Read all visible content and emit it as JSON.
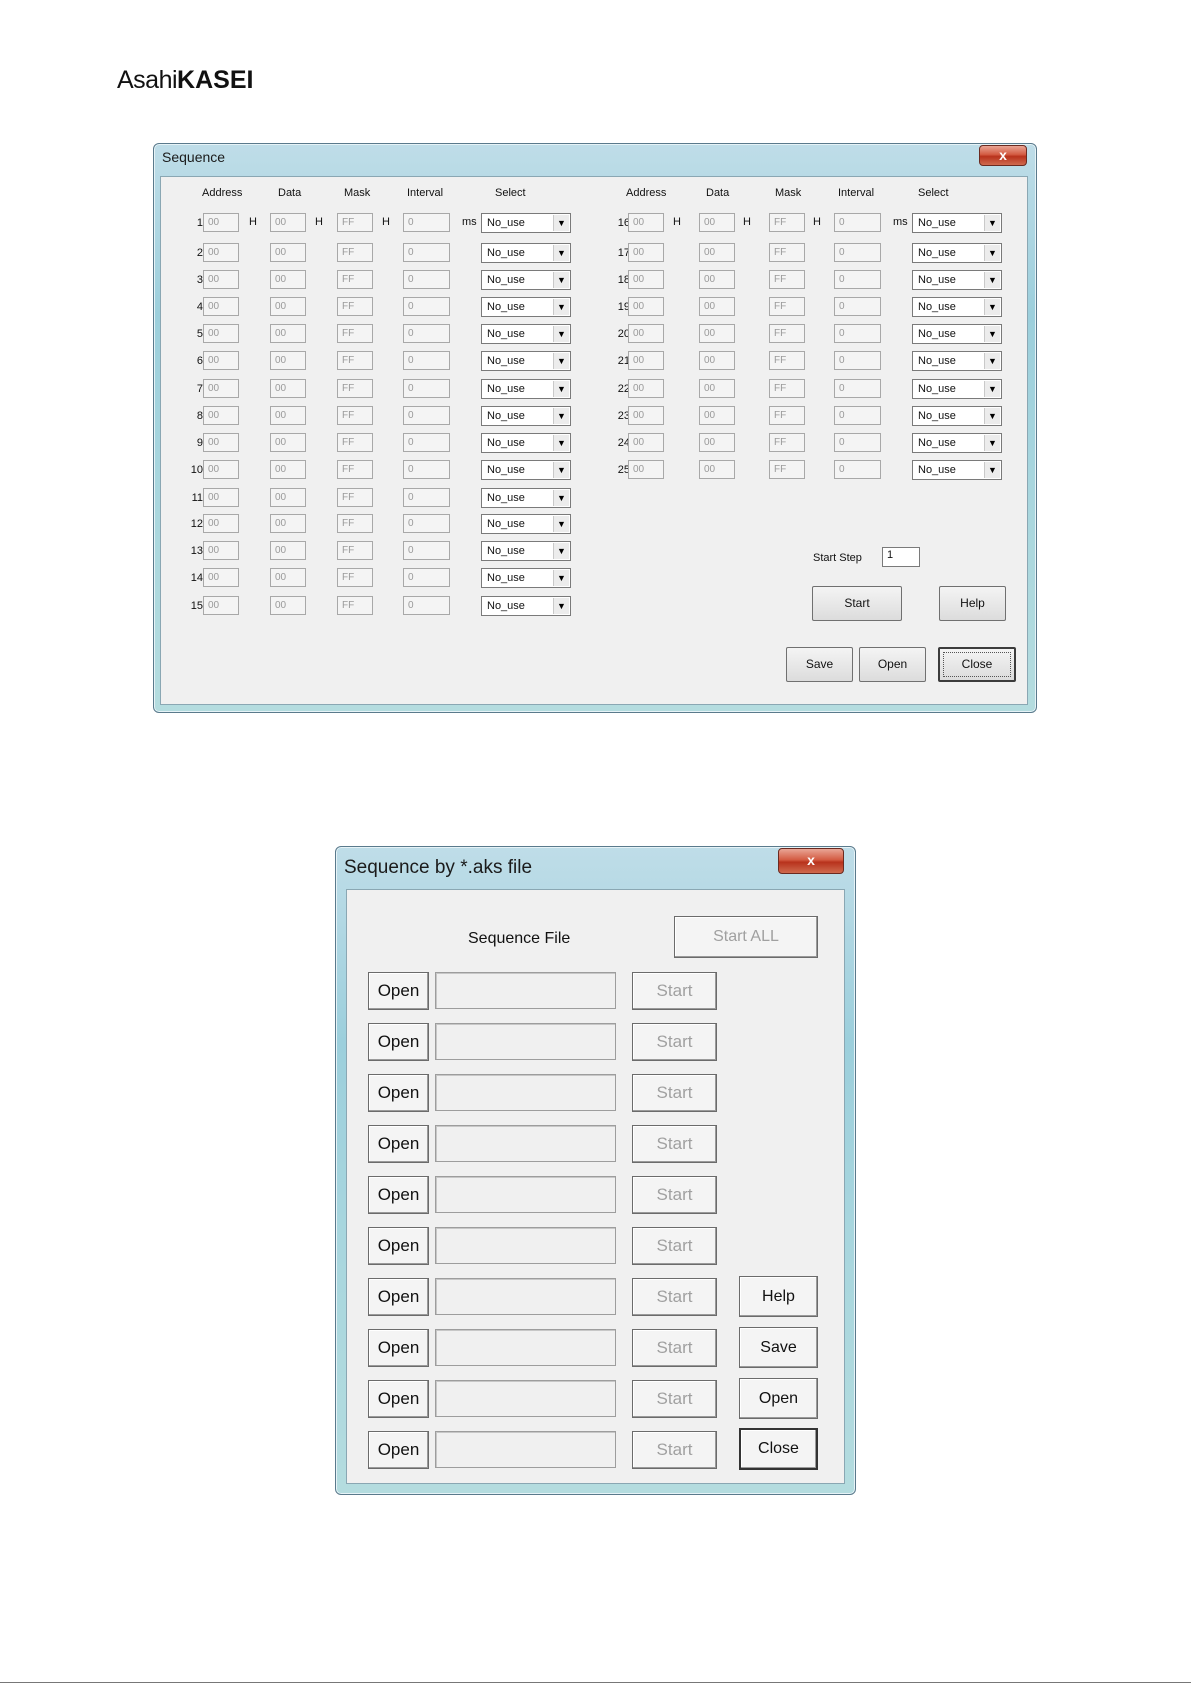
{
  "brand": {
    "prefix": "Asahi",
    "bold": "KASEI"
  },
  "seq": {
    "title": "Sequence",
    "close_glyph": "x",
    "headers": {
      "address": "Address",
      "data": "Data",
      "mask": "Mask",
      "interval": "Interval",
      "select": "Select"
    },
    "units": {
      "hex": "H",
      "ms": "ms"
    },
    "rows_left": [
      {
        "n": "1",
        "address": "00",
        "data": "00",
        "mask": "FF",
        "interval": "0",
        "select": "No_use"
      },
      {
        "n": "2",
        "address": "00",
        "data": "00",
        "mask": "FF",
        "interval": "0",
        "select": "No_use"
      },
      {
        "n": "3",
        "address": "00",
        "data": "00",
        "mask": "FF",
        "interval": "0",
        "select": "No_use"
      },
      {
        "n": "4",
        "address": "00",
        "data": "00",
        "mask": "FF",
        "interval": "0",
        "select": "No_use"
      },
      {
        "n": "5",
        "address": "00",
        "data": "00",
        "mask": "FF",
        "interval": "0",
        "select": "No_use"
      },
      {
        "n": "6",
        "address": "00",
        "data": "00",
        "mask": "FF",
        "interval": "0",
        "select": "No_use"
      },
      {
        "n": "7",
        "address": "00",
        "data": "00",
        "mask": "FF",
        "interval": "0",
        "select": "No_use"
      },
      {
        "n": "8",
        "address": "00",
        "data": "00",
        "mask": "FF",
        "interval": "0",
        "select": "No_use"
      },
      {
        "n": "9",
        "address": "00",
        "data": "00",
        "mask": "FF",
        "interval": "0",
        "select": "No_use"
      },
      {
        "n": "10",
        "address": "00",
        "data": "00",
        "mask": "FF",
        "interval": "0",
        "select": "No_use"
      },
      {
        "n": "11",
        "address": "00",
        "data": "00",
        "mask": "FF",
        "interval": "0",
        "select": "No_use"
      },
      {
        "n": "12",
        "address": "00",
        "data": "00",
        "mask": "FF",
        "interval": "0",
        "select": "No_use"
      },
      {
        "n": "13",
        "address": "00",
        "data": "00",
        "mask": "FF",
        "interval": "0",
        "select": "No_use"
      },
      {
        "n": "14",
        "address": "00",
        "data": "00",
        "mask": "FF",
        "interval": "0",
        "select": "No_use"
      },
      {
        "n": "15",
        "address": "00",
        "data": "00",
        "mask": "FF",
        "interval": "0",
        "select": "No_use"
      }
    ],
    "rows_right": [
      {
        "n": "16",
        "address": "00",
        "data": "00",
        "mask": "FF",
        "interval": "0",
        "select": "No_use"
      },
      {
        "n": "17",
        "address": "00",
        "data": "00",
        "mask": "FF",
        "interval": "0",
        "select": "No_use"
      },
      {
        "n": "18",
        "address": "00",
        "data": "00",
        "mask": "FF",
        "interval": "0",
        "select": "No_use"
      },
      {
        "n": "19",
        "address": "00",
        "data": "00",
        "mask": "FF",
        "interval": "0",
        "select": "No_use"
      },
      {
        "n": "20",
        "address": "00",
        "data": "00",
        "mask": "FF",
        "interval": "0",
        "select": "No_use"
      },
      {
        "n": "21",
        "address": "00",
        "data": "00",
        "mask": "FF",
        "interval": "0",
        "select": "No_use"
      },
      {
        "n": "22",
        "address": "00",
        "data": "00",
        "mask": "FF",
        "interval": "0",
        "select": "No_use"
      },
      {
        "n": "23",
        "address": "00",
        "data": "00",
        "mask": "FF",
        "interval": "0",
        "select": "No_use"
      },
      {
        "n": "24",
        "address": "00",
        "data": "00",
        "mask": "FF",
        "interval": "0",
        "select": "No_use"
      },
      {
        "n": "25",
        "address": "00",
        "data": "00",
        "mask": "FF",
        "interval": "0",
        "select": "No_use"
      }
    ],
    "start_step_label": "Start Step",
    "start_step_value": "1",
    "buttons": {
      "start": "Start",
      "help": "Help",
      "save": "Save",
      "open": "Open",
      "close": "Close"
    }
  },
  "aks": {
    "title": "Sequence by *.aks file",
    "close_glyph": "x",
    "sequence_file_label": "Sequence File",
    "start_all": "Start ALL",
    "rows": [
      {
        "open": "Open",
        "file": "",
        "start": "Start"
      },
      {
        "open": "Open",
        "file": "",
        "start": "Start"
      },
      {
        "open": "Open",
        "file": "",
        "start": "Start"
      },
      {
        "open": "Open",
        "file": "",
        "start": "Start"
      },
      {
        "open": "Open",
        "file": "",
        "start": "Start"
      },
      {
        "open": "Open",
        "file": "",
        "start": "Start"
      },
      {
        "open": "Open",
        "file": "",
        "start": "Start"
      },
      {
        "open": "Open",
        "file": "",
        "start": "Start"
      },
      {
        "open": "Open",
        "file": "",
        "start": "Start"
      },
      {
        "open": "Open",
        "file": "",
        "start": "Start"
      }
    ],
    "buttons": {
      "help": "Help",
      "save": "Save",
      "open": "Open",
      "close": "Close"
    }
  }
}
